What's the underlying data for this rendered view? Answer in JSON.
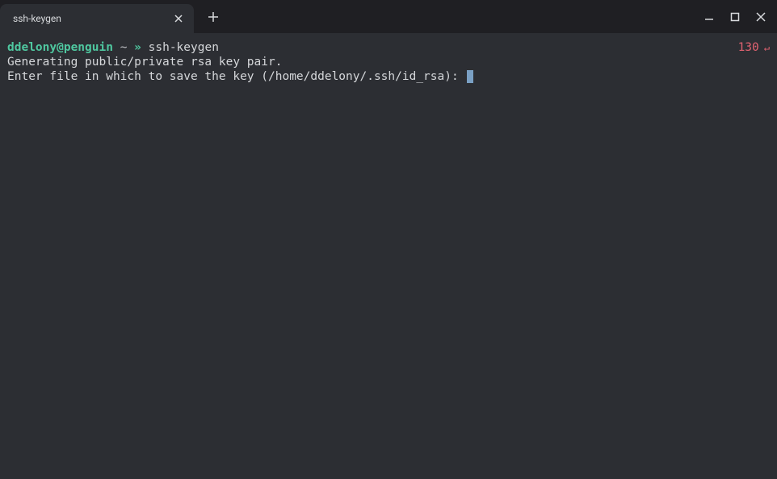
{
  "tab": {
    "title": "ssh-keygen"
  },
  "prompt": {
    "user_host": "ddelony@penguin",
    "cwd": "~",
    "symbol": "»",
    "command": "ssh-keygen",
    "status_code": "130",
    "status_arrow": "↵"
  },
  "output": {
    "line1": "Generating public/private rsa key pair.",
    "line2": "Enter file in which to save the key (/home/ddelony/.ssh/id_rsa): "
  }
}
